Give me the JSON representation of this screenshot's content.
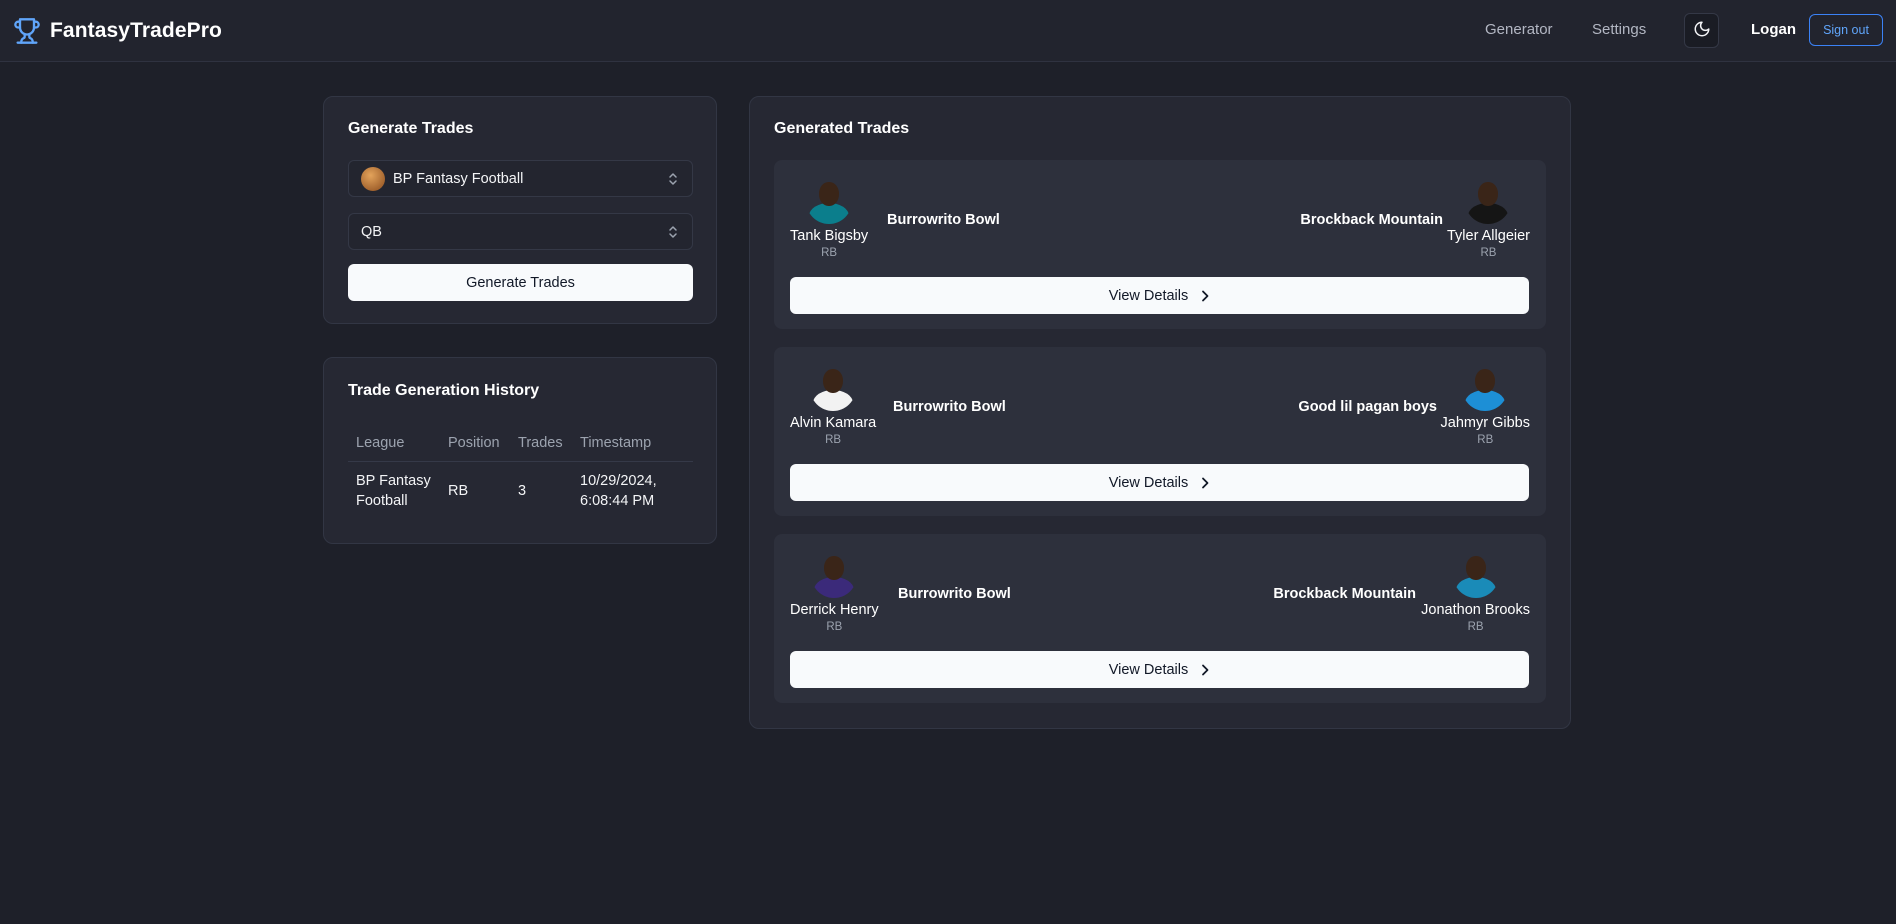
{
  "header": {
    "brand": "FantasyTradePro",
    "nav": {
      "generator": "Generator",
      "settings": "Settings"
    },
    "user": "Logan",
    "signout": "Sign out",
    "accent": "#60a5fa"
  },
  "generate": {
    "title": "Generate Trades",
    "league": "BP Fantasy Football",
    "position": "QB",
    "button": "Generate Trades"
  },
  "history": {
    "title": "Trade Generation History",
    "columns": [
      "League",
      "Position",
      "Trades",
      "Timestamp"
    ],
    "rows": [
      {
        "league": "BP Fantasy Football",
        "position": "RB",
        "trades": "3",
        "timestamp": "10/29/2024, 6:08:44 PM"
      }
    ]
  },
  "trades": {
    "title": "Generated Trades",
    "details_label": "View Details",
    "items": [
      {
        "left": {
          "player": "Tank Bigsby",
          "pos": "RB",
          "team": "Burrowrito Bowl",
          "jersey": "#0b7e8c"
        },
        "right": {
          "player": "Tyler Allgeier",
          "pos": "RB",
          "team": "Brockback Mountain",
          "jersey": "#151515"
        }
      },
      {
        "left": {
          "player": "Alvin Kamara",
          "pos": "RB",
          "team": "Burrowrito Bowl",
          "jersey": "#f2f2f2"
        },
        "right": {
          "player": "Jahmyr Gibbs",
          "pos": "RB",
          "team": "Good lil pagan boys",
          "jersey": "#1d8fd6"
        }
      },
      {
        "left": {
          "player": "Derrick Henry",
          "pos": "RB",
          "team": "Burrowrito Bowl",
          "jersey": "#3b2a7a"
        },
        "right": {
          "player": "Jonathon Brooks",
          "pos": "RB",
          "team": "Brockback Mountain",
          "jersey": "#1a8bb8"
        }
      }
    ]
  }
}
